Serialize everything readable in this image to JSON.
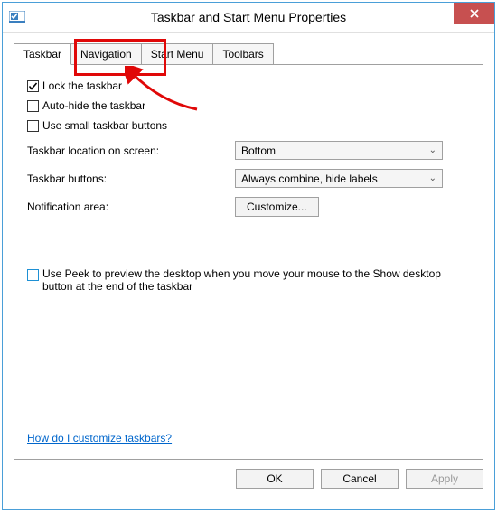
{
  "title": "Taskbar and Start Menu Properties",
  "tabs": {
    "taskbar": "Taskbar",
    "navigation": "Navigation",
    "startmenu": "Start Menu",
    "toolbars": "Toolbars"
  },
  "checkboxes": {
    "lock": "Lock the taskbar",
    "autohide": "Auto-hide the taskbar",
    "small": "Use small taskbar buttons",
    "peek": "Use Peek to preview the desktop when you move your mouse to the Show desktop button at the end of the taskbar"
  },
  "labels": {
    "location": "Taskbar location on screen:",
    "buttons": "Taskbar buttons:",
    "notification": "Notification area:"
  },
  "values": {
    "location": "Bottom",
    "buttons": "Always combine, hide labels"
  },
  "btns": {
    "customize": "Customize...",
    "ok": "OK",
    "cancel": "Cancel",
    "apply": "Apply"
  },
  "help": "How do I customize taskbars?"
}
